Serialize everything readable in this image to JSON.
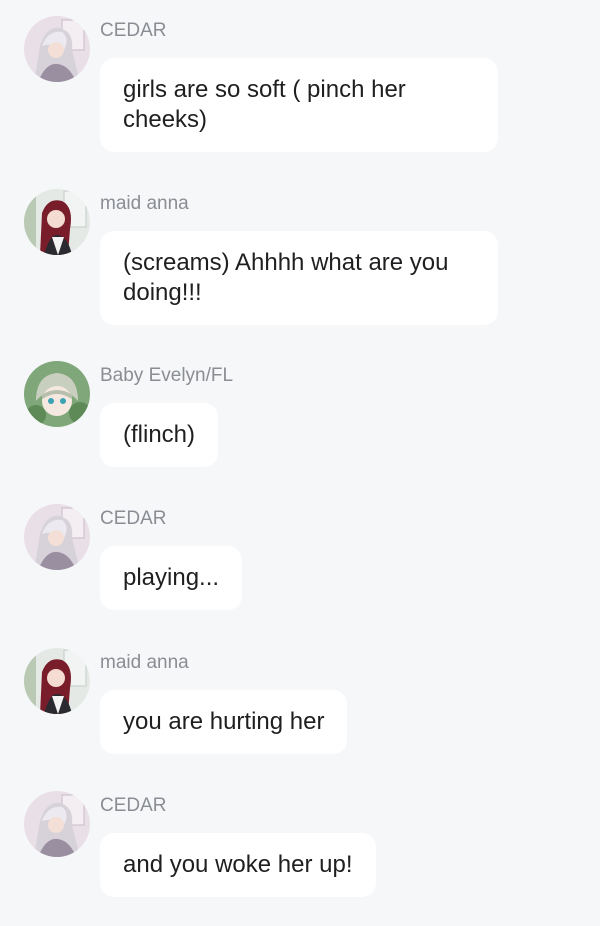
{
  "messages": [
    {
      "sender": "CEDAR",
      "avatar": "cedar-avatar",
      "text": "girls are so soft ( pinch her cheeks)"
    },
    {
      "sender": "maid anna",
      "avatar": "maid-anna-avatar",
      "text": "(screams) Ahhhh what are you doing!!!"
    },
    {
      "sender": "Baby Evelyn/FL",
      "avatar": "baby-evelyn-avatar",
      "text": "(flinch)"
    },
    {
      "sender": "CEDAR",
      "avatar": "cedar-avatar",
      "text": "playing..."
    },
    {
      "sender": "maid anna",
      "avatar": "maid-anna-avatar",
      "text": "you are hurting her"
    },
    {
      "sender": "CEDAR",
      "avatar": "cedar-avatar",
      "text": "and you woke her up!"
    }
  ],
  "colors": {
    "background": "#f6f7f9",
    "bubble": "#ffffff",
    "sender_text": "#8a8d93",
    "message_text": "#1f1f21"
  }
}
